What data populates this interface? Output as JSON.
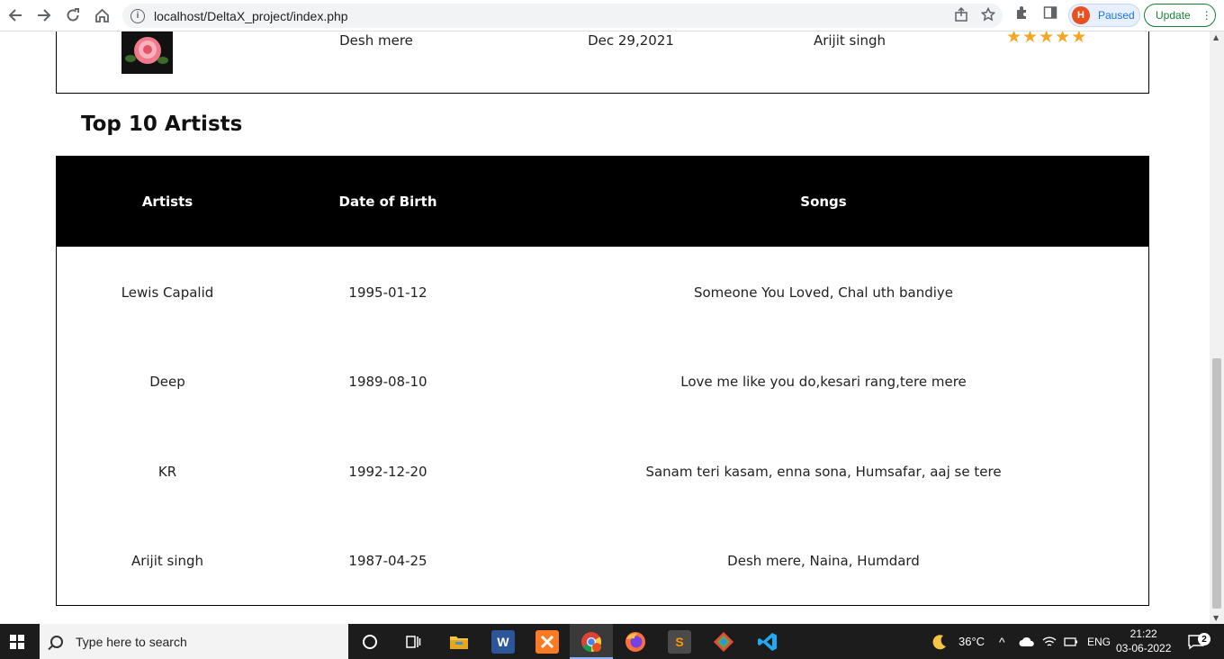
{
  "browser": {
    "url": "localhost/DeltaX_project/index.php",
    "profile_initial": "H",
    "profile_status": "Paused",
    "update_label": "Update"
  },
  "last_song": {
    "title": "Desh mere",
    "date": "Dec 29,2021",
    "artist": "Arijit singh",
    "rating": 5
  },
  "artists_section": {
    "title": "Top 10 Artists",
    "headers": [
      "Artists",
      "Date of Birth",
      "Songs"
    ],
    "rows": [
      {
        "artist": "Lewis Capalid",
        "dob": "1995-01-12",
        "songs": "Someone You Loved, Chal uth bandiye"
      },
      {
        "artist": "Deep",
        "dob": "1989-08-10",
        "songs": "Love me like you do,kesari rang,tere mere"
      },
      {
        "artist": "KR",
        "dob": "1992-12-20",
        "songs": "Sanam teri kasam, enna sona, Humsafar, aaj se tere"
      },
      {
        "artist": "Arijit singh",
        "dob": "1987-04-25",
        "songs": "Desh mere, Naina, Humdard"
      }
    ]
  },
  "taskbar": {
    "search_placeholder": "Type here to search",
    "weather": "36°C",
    "language": "ENG",
    "time": "21:22",
    "date": "03-06-2022",
    "notifications": "2"
  },
  "colors": {
    "star": "#f5a623",
    "table_header_bg": "#000000",
    "profile_avatar": "#e8501e",
    "update_green": "#188038"
  }
}
